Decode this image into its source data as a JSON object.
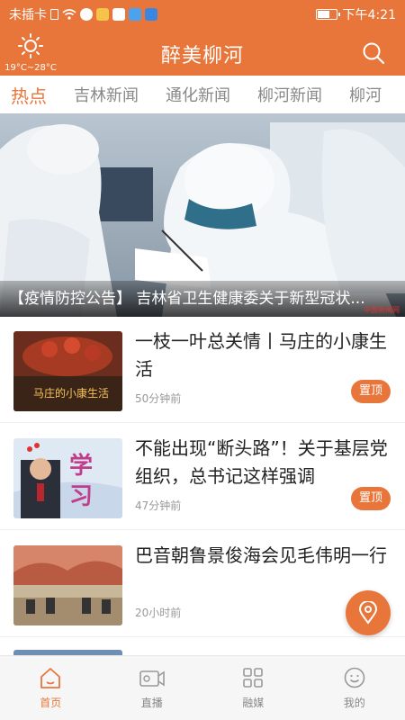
{
  "statusbar": {
    "carrier": "未插卡",
    "time": "下午4:21",
    "battery_level": 0.7
  },
  "header": {
    "title": "醉美柳河",
    "weather_temp": "19°C~28°C"
  },
  "tabs": [
    {
      "label": "热点",
      "active": true
    },
    {
      "label": "吉林新闻",
      "active": false
    },
    {
      "label": "通化新闻",
      "active": false
    },
    {
      "label": "柳河新闻",
      "active": false
    },
    {
      "label": "柳河",
      "active": false
    }
  ],
  "banner": {
    "caption": "【疫情防控公告】 吉林省卫生健康委关于新型冠状...",
    "watermark": "中国新闻网"
  },
  "news": [
    {
      "headline": "一枝一叶总关情丨马庄的小康生活",
      "time": "50分钟前",
      "pin": "置顶",
      "thumb_text": "马庄的小康生活"
    },
    {
      "headline": "不能出现“断头路”！关于基层党组织，总书记这样强调",
      "time": "47分钟前",
      "pin": "置顶",
      "thumb_text": "学 习"
    },
    {
      "headline": "巴音朝鲁景俊海会见毛伟明一行",
      "time": "20小时前",
      "pin": ""
    }
  ],
  "bottom_nav": [
    {
      "label": "首页",
      "icon": "home-icon",
      "active": true
    },
    {
      "label": "直播",
      "icon": "camera-icon",
      "active": false
    },
    {
      "label": "融媒",
      "icon": "grid-icon",
      "active": false
    },
    {
      "label": "我的",
      "icon": "smile-icon",
      "active": false
    }
  ],
  "colors": {
    "accent": "#e8763a"
  }
}
